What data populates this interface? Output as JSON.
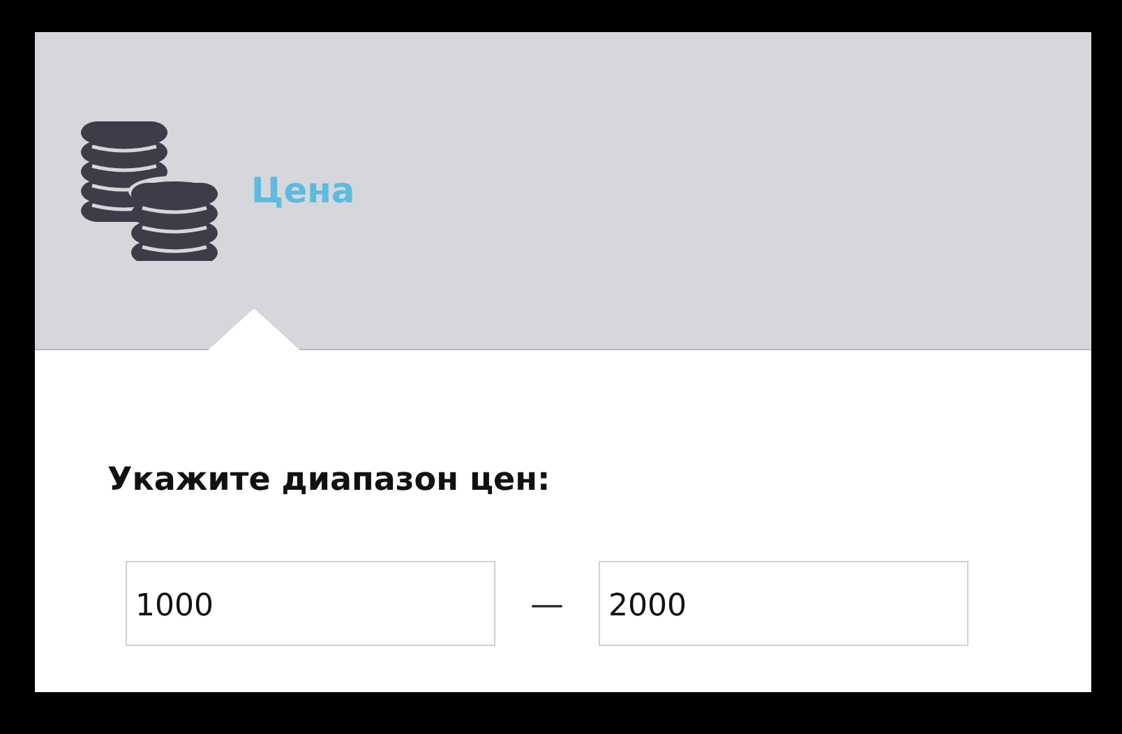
{
  "filter": {
    "title": "Цена",
    "label": "Укажите диапазон цен:",
    "from": {
      "value": "1000"
    },
    "separator": "—",
    "to": {
      "value": "2000"
    }
  }
}
